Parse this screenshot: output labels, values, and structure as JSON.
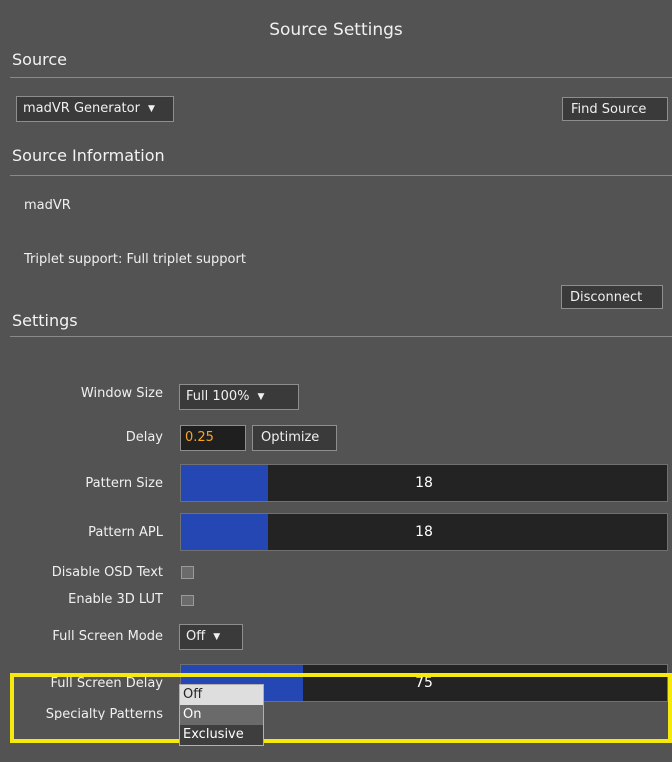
{
  "dialog": {
    "title": "Source Settings"
  },
  "source": {
    "section_label": "Source",
    "selected": "madVR Generator",
    "find_button": "Find Source"
  },
  "info": {
    "section_label": "Source Information",
    "name": "madVR",
    "triplet": "Triplet support: Full triplet support",
    "disconnect_button": "Disconnect"
  },
  "settings": {
    "section_label": "Settings",
    "window_size": {
      "label": "Window Size",
      "value": "Full 100%"
    },
    "delay": {
      "label": "Delay",
      "value": "0.25",
      "optimize_button": "Optimize"
    },
    "pattern_size": {
      "label": "Pattern Size",
      "value": "18",
      "fill_fraction": 0.18
    },
    "pattern_apl": {
      "label": "Pattern APL",
      "value": "18",
      "fill_fraction": 0.18
    },
    "disable_osd": {
      "label": "Disable OSD Text",
      "checked": false
    },
    "enable_3dlut": {
      "label": "Enable 3D LUT",
      "checked": false
    },
    "full_screen_mode": {
      "label": "Full Screen Mode",
      "value": "Off",
      "options": [
        "Off",
        "On",
        "Exclusive"
      ]
    },
    "full_screen_delay": {
      "label": "Full Screen Delay",
      "value": "75",
      "fill_fraction": 0.25
    },
    "specialty_patterns": {
      "label": "Specialty Patterns"
    }
  },
  "colors": {
    "highlight": "#f5ea0c",
    "slider_fill": "#2447b4",
    "delay_text": "#f5a623"
  }
}
